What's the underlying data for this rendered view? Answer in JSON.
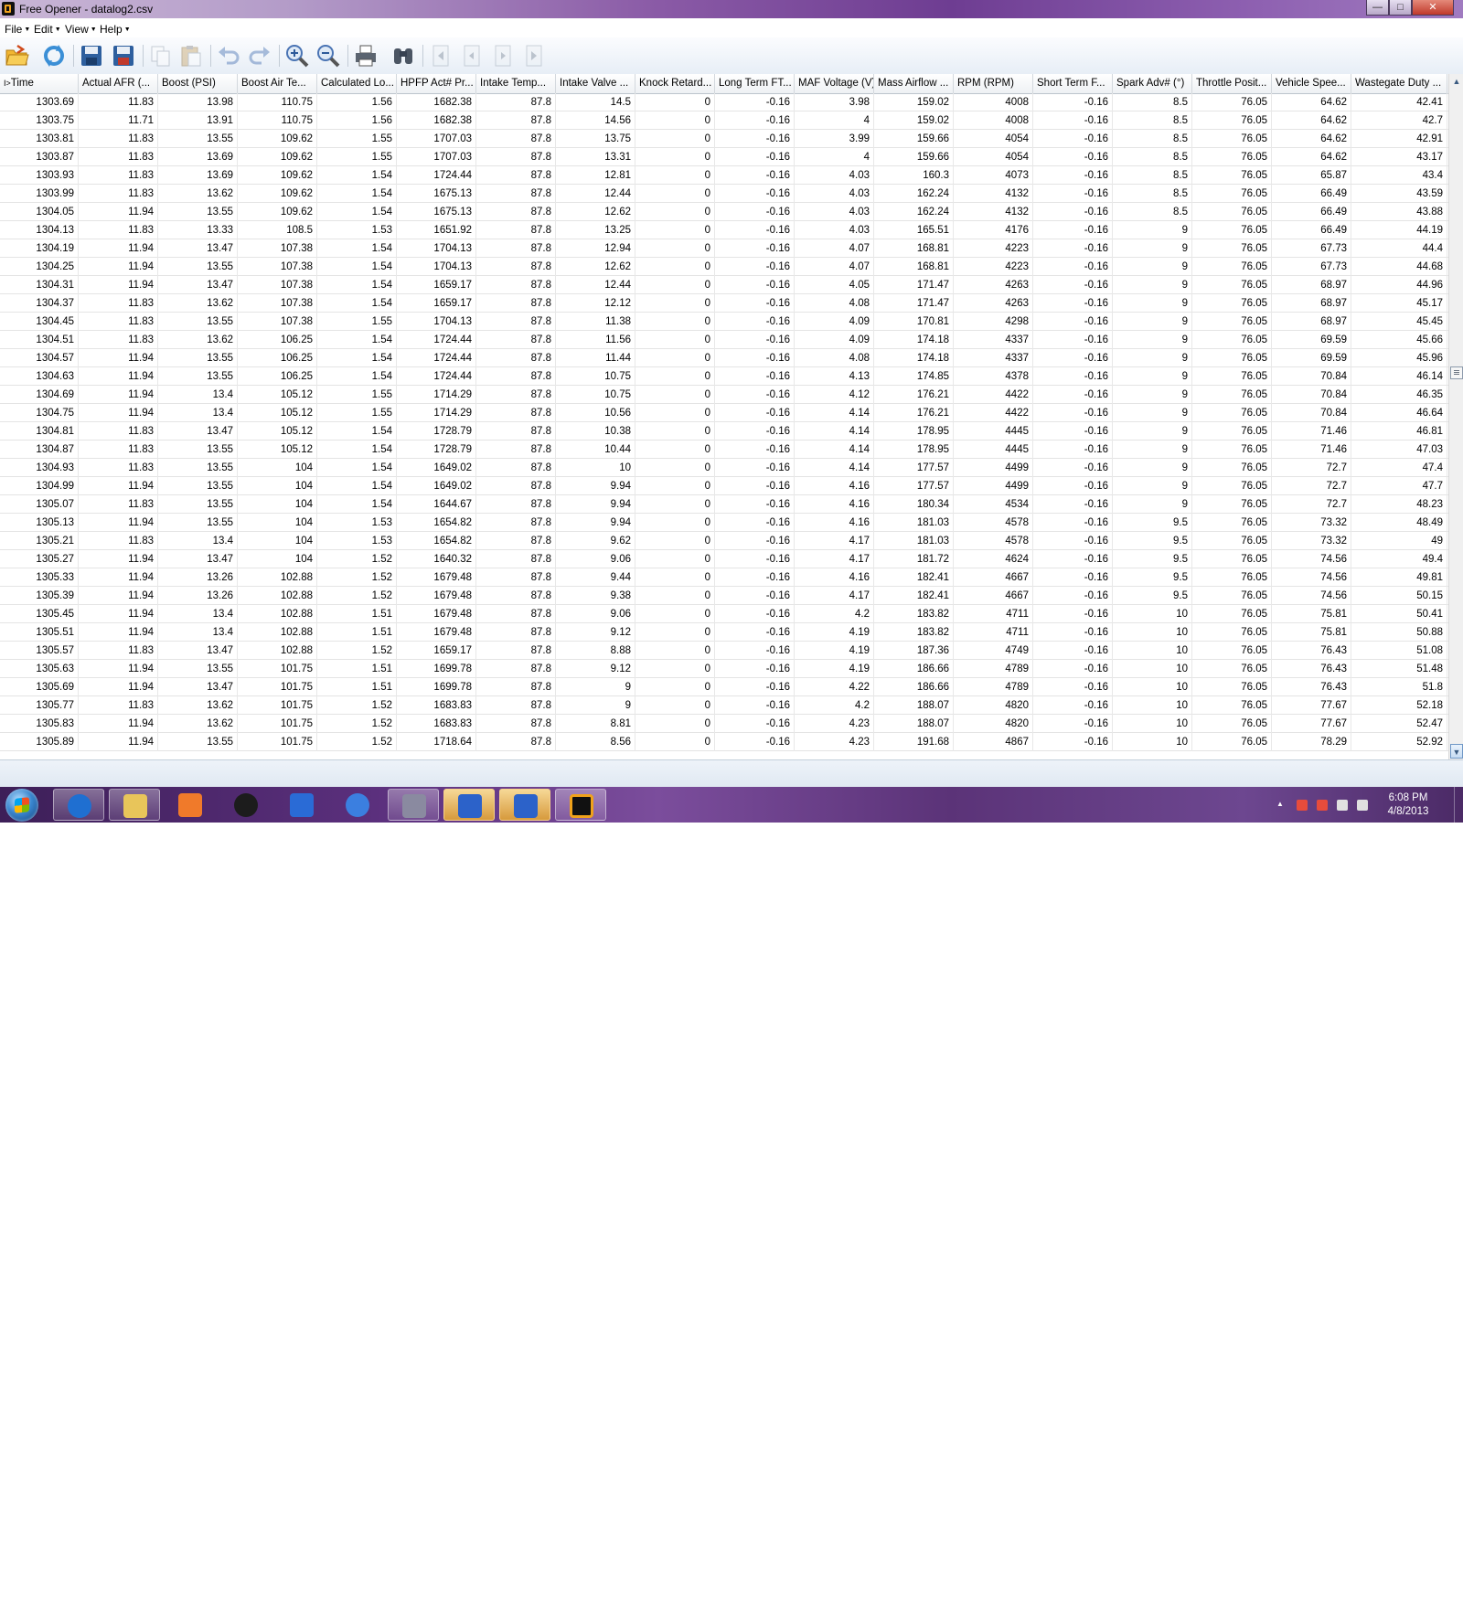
{
  "window": {
    "title": "Free Opener - datalog2.csv",
    "buttons": {
      "minimize": "—",
      "maximize": "□",
      "close": "✕"
    }
  },
  "menu": [
    {
      "label": "File"
    },
    {
      "label": "Edit"
    },
    {
      "label": "View"
    },
    {
      "label": "Help"
    }
  ],
  "toolbar": [
    "open-folder-icon",
    "refresh-icon",
    "save-icon",
    "save-as-icon",
    "copy-icon",
    "paste-icon",
    "undo-icon",
    "redo-icon",
    "zoom-in-icon",
    "zoom-out-icon",
    "print-icon",
    "find-icon",
    "first-page-icon",
    "previous-page-icon",
    "next-page-icon",
    "last-page-icon"
  ],
  "grid": {
    "columns": [
      "Time",
      "Actual AFR (...",
      "Boost (PSI)",
      "Boost Air Te...",
      "Calculated Lo...",
      "HPFP Act# Pr...",
      "Intake Temp...",
      "Intake Valve ...",
      "Knock Retard...",
      "Long Term FT...",
      "MAF Voltage (V)",
      "Mass Airflow ...",
      "RPM (RPM)",
      "Short Term F...",
      "Spark Adv# (°)",
      "Throttle Posit...",
      "Vehicle Spee...",
      "Wastegate Duty ..."
    ],
    "sort_indicator": "I>",
    "rows": [
      [
        "1303.69",
        "11.83",
        "13.98",
        "110.75",
        "1.56",
        "1682.38",
        "87.8",
        "14.5",
        "0",
        "-0.16",
        "3.98",
        "159.02",
        "4008",
        "-0.16",
        "8.5",
        "76.05",
        "64.62",
        "42.41"
      ],
      [
        "1303.75",
        "11.71",
        "13.91",
        "110.75",
        "1.56",
        "1682.38",
        "87.8",
        "14.56",
        "0",
        "-0.16",
        "4",
        "159.02",
        "4008",
        "-0.16",
        "8.5",
        "76.05",
        "64.62",
        "42.7"
      ],
      [
        "1303.81",
        "11.83",
        "13.55",
        "109.62",
        "1.55",
        "1707.03",
        "87.8",
        "13.75",
        "0",
        "-0.16",
        "3.99",
        "159.66",
        "4054",
        "-0.16",
        "8.5",
        "76.05",
        "64.62",
        "42.91"
      ],
      [
        "1303.87",
        "11.83",
        "13.69",
        "109.62",
        "1.55",
        "1707.03",
        "87.8",
        "13.31",
        "0",
        "-0.16",
        "4",
        "159.66",
        "4054",
        "-0.16",
        "8.5",
        "76.05",
        "64.62",
        "43.17"
      ],
      [
        "1303.93",
        "11.83",
        "13.69",
        "109.62",
        "1.54",
        "1724.44",
        "87.8",
        "12.81",
        "0",
        "-0.16",
        "4.03",
        "160.3",
        "4073",
        "-0.16",
        "8.5",
        "76.05",
        "65.87",
        "43.4"
      ],
      [
        "1303.99",
        "11.83",
        "13.62",
        "109.62",
        "1.54",
        "1675.13",
        "87.8",
        "12.44",
        "0",
        "-0.16",
        "4.03",
        "162.24",
        "4132",
        "-0.16",
        "8.5",
        "76.05",
        "66.49",
        "43.59"
      ],
      [
        "1304.05",
        "11.94",
        "13.55",
        "109.62",
        "1.54",
        "1675.13",
        "87.8",
        "12.62",
        "0",
        "-0.16",
        "4.03",
        "162.24",
        "4132",
        "-0.16",
        "8.5",
        "76.05",
        "66.49",
        "43.88"
      ],
      [
        "1304.13",
        "11.83",
        "13.33",
        "108.5",
        "1.53",
        "1651.92",
        "87.8",
        "13.25",
        "0",
        "-0.16",
        "4.03",
        "165.51",
        "4176",
        "-0.16",
        "9",
        "76.05",
        "66.49",
        "44.19"
      ],
      [
        "1304.19",
        "11.94",
        "13.47",
        "107.38",
        "1.54",
        "1704.13",
        "87.8",
        "12.94",
        "0",
        "-0.16",
        "4.07",
        "168.81",
        "4223",
        "-0.16",
        "9",
        "76.05",
        "67.73",
        "44.4"
      ],
      [
        "1304.25",
        "11.94",
        "13.55",
        "107.38",
        "1.54",
        "1704.13",
        "87.8",
        "12.62",
        "0",
        "-0.16",
        "4.07",
        "168.81",
        "4223",
        "-0.16",
        "9",
        "76.05",
        "67.73",
        "44.68"
      ],
      [
        "1304.31",
        "11.94",
        "13.47",
        "107.38",
        "1.54",
        "1659.17",
        "87.8",
        "12.44",
        "0",
        "-0.16",
        "4.05",
        "171.47",
        "4263",
        "-0.16",
        "9",
        "76.05",
        "68.97",
        "44.96"
      ],
      [
        "1304.37",
        "11.83",
        "13.62",
        "107.38",
        "1.54",
        "1659.17",
        "87.8",
        "12.12",
        "0",
        "-0.16",
        "4.08",
        "171.47",
        "4263",
        "-0.16",
        "9",
        "76.05",
        "68.97",
        "45.17"
      ],
      [
        "1304.45",
        "11.83",
        "13.55",
        "107.38",
        "1.55",
        "1704.13",
        "87.8",
        "11.38",
        "0",
        "-0.16",
        "4.09",
        "170.81",
        "4298",
        "-0.16",
        "9",
        "76.05",
        "68.97",
        "45.45"
      ],
      [
        "1304.51",
        "11.83",
        "13.62",
        "106.25",
        "1.54",
        "1724.44",
        "87.8",
        "11.56",
        "0",
        "-0.16",
        "4.09",
        "174.18",
        "4337",
        "-0.16",
        "9",
        "76.05",
        "69.59",
        "45.66"
      ],
      [
        "1304.57",
        "11.94",
        "13.55",
        "106.25",
        "1.54",
        "1724.44",
        "87.8",
        "11.44",
        "0",
        "-0.16",
        "4.08",
        "174.18",
        "4337",
        "-0.16",
        "9",
        "76.05",
        "69.59",
        "45.96"
      ],
      [
        "1304.63",
        "11.94",
        "13.55",
        "106.25",
        "1.54",
        "1724.44",
        "87.8",
        "10.75",
        "0",
        "-0.16",
        "4.13",
        "174.85",
        "4378",
        "-0.16",
        "9",
        "76.05",
        "70.84",
        "46.14"
      ],
      [
        "1304.69",
        "11.94",
        "13.4",
        "105.12",
        "1.55",
        "1714.29",
        "87.8",
        "10.75",
        "0",
        "-0.16",
        "4.12",
        "176.21",
        "4422",
        "-0.16",
        "9",
        "76.05",
        "70.84",
        "46.35"
      ],
      [
        "1304.75",
        "11.94",
        "13.4",
        "105.12",
        "1.55",
        "1714.29",
        "87.8",
        "10.56",
        "0",
        "-0.16",
        "4.14",
        "176.21",
        "4422",
        "-0.16",
        "9",
        "76.05",
        "70.84",
        "46.64"
      ],
      [
        "1304.81",
        "11.83",
        "13.47",
        "105.12",
        "1.54",
        "1728.79",
        "87.8",
        "10.38",
        "0",
        "-0.16",
        "4.14",
        "178.95",
        "4445",
        "-0.16",
        "9",
        "76.05",
        "71.46",
        "46.81"
      ],
      [
        "1304.87",
        "11.83",
        "13.55",
        "105.12",
        "1.54",
        "1728.79",
        "87.8",
        "10.44",
        "0",
        "-0.16",
        "4.14",
        "178.95",
        "4445",
        "-0.16",
        "9",
        "76.05",
        "71.46",
        "47.03"
      ],
      [
        "1304.93",
        "11.83",
        "13.55",
        "104",
        "1.54",
        "1649.02",
        "87.8",
        "10",
        "0",
        "-0.16",
        "4.14",
        "177.57",
        "4499",
        "-0.16",
        "9",
        "76.05",
        "72.7",
        "47.4"
      ],
      [
        "1304.99",
        "11.94",
        "13.55",
        "104",
        "1.54",
        "1649.02",
        "87.8",
        "9.94",
        "0",
        "-0.16",
        "4.16",
        "177.57",
        "4499",
        "-0.16",
        "9",
        "76.05",
        "72.7",
        "47.7"
      ],
      [
        "1305.07",
        "11.83",
        "13.55",
        "104",
        "1.54",
        "1644.67",
        "87.8",
        "9.94",
        "0",
        "-0.16",
        "4.16",
        "180.34",
        "4534",
        "-0.16",
        "9",
        "76.05",
        "72.7",
        "48.23"
      ],
      [
        "1305.13",
        "11.94",
        "13.55",
        "104",
        "1.53",
        "1654.82",
        "87.8",
        "9.94",
        "0",
        "-0.16",
        "4.16",
        "181.03",
        "4578",
        "-0.16",
        "9.5",
        "76.05",
        "73.32",
        "48.49"
      ],
      [
        "1305.21",
        "11.83",
        "13.4",
        "104",
        "1.53",
        "1654.82",
        "87.8",
        "9.62",
        "0",
        "-0.16",
        "4.17",
        "181.03",
        "4578",
        "-0.16",
        "9.5",
        "76.05",
        "73.32",
        "49"
      ],
      [
        "1305.27",
        "11.94",
        "13.47",
        "104",
        "1.52",
        "1640.32",
        "87.8",
        "9.06",
        "0",
        "-0.16",
        "4.17",
        "181.72",
        "4624",
        "-0.16",
        "9.5",
        "76.05",
        "74.56",
        "49.4"
      ],
      [
        "1305.33",
        "11.94",
        "13.26",
        "102.88",
        "1.52",
        "1679.48",
        "87.8",
        "9.44",
        "0",
        "-0.16",
        "4.16",
        "182.41",
        "4667",
        "-0.16",
        "9.5",
        "76.05",
        "74.56",
        "49.81"
      ],
      [
        "1305.39",
        "11.94",
        "13.26",
        "102.88",
        "1.52",
        "1679.48",
        "87.8",
        "9.38",
        "0",
        "-0.16",
        "4.17",
        "182.41",
        "4667",
        "-0.16",
        "9.5",
        "76.05",
        "74.56",
        "50.15"
      ],
      [
        "1305.45",
        "11.94",
        "13.4",
        "102.88",
        "1.51",
        "1679.48",
        "87.8",
        "9.06",
        "0",
        "-0.16",
        "4.2",
        "183.82",
        "4711",
        "-0.16",
        "10",
        "76.05",
        "75.81",
        "50.41"
      ],
      [
        "1305.51",
        "11.94",
        "13.4",
        "102.88",
        "1.51",
        "1679.48",
        "87.8",
        "9.12",
        "0",
        "-0.16",
        "4.19",
        "183.82",
        "4711",
        "-0.16",
        "10",
        "76.05",
        "75.81",
        "50.88"
      ],
      [
        "1305.57",
        "11.83",
        "13.47",
        "102.88",
        "1.52",
        "1659.17",
        "87.8",
        "8.88",
        "0",
        "-0.16",
        "4.19",
        "187.36",
        "4749",
        "-0.16",
        "10",
        "76.05",
        "76.43",
        "51.08"
      ],
      [
        "1305.63",
        "11.94",
        "13.55",
        "101.75",
        "1.51",
        "1699.78",
        "87.8",
        "9.12",
        "0",
        "-0.16",
        "4.19",
        "186.66",
        "4789",
        "-0.16",
        "10",
        "76.05",
        "76.43",
        "51.48"
      ],
      [
        "1305.69",
        "11.94",
        "13.47",
        "101.75",
        "1.51",
        "1699.78",
        "87.8",
        "9",
        "0",
        "-0.16",
        "4.22",
        "186.66",
        "4789",
        "-0.16",
        "10",
        "76.05",
        "76.43",
        "51.8"
      ],
      [
        "1305.77",
        "11.83",
        "13.62",
        "101.75",
        "1.52",
        "1683.83",
        "87.8",
        "9",
        "0",
        "-0.16",
        "4.2",
        "188.07",
        "4820",
        "-0.16",
        "10",
        "76.05",
        "77.67",
        "52.18"
      ],
      [
        "1305.83",
        "11.94",
        "13.62",
        "101.75",
        "1.52",
        "1683.83",
        "87.8",
        "8.81",
        "0",
        "-0.16",
        "4.23",
        "188.07",
        "4820",
        "-0.16",
        "10",
        "76.05",
        "77.67",
        "52.47"
      ],
      [
        "1305.89",
        "11.94",
        "13.55",
        "101.75",
        "1.52",
        "1718.64",
        "87.8",
        "8.56",
        "0",
        "-0.16",
        "4.23",
        "191.68",
        "4867",
        "-0.16",
        "10",
        "76.05",
        "78.29",
        "52.92"
      ]
    ]
  },
  "taskbar": {
    "apps": [
      "internet-explorer-icon",
      "file-explorer-icon",
      "media-player-icon",
      "hp-icon",
      "stock-app-icon",
      "itunes-icon",
      "phone-app-icon",
      "security-shield-icon",
      "security-shield-icon",
      "free-opener-icon"
    ],
    "tray": [
      "show-hidden-icons-icon",
      "action-center-icon",
      "power-icon",
      "network-icon",
      "volume-icon"
    ],
    "time": "6:08 PM",
    "date": "4/8/2013"
  },
  "colors": {
    "titlebar": "#8a5aa6",
    "taskbar": "#5a2f7c",
    "grid_header": "#eef1f4"
  }
}
